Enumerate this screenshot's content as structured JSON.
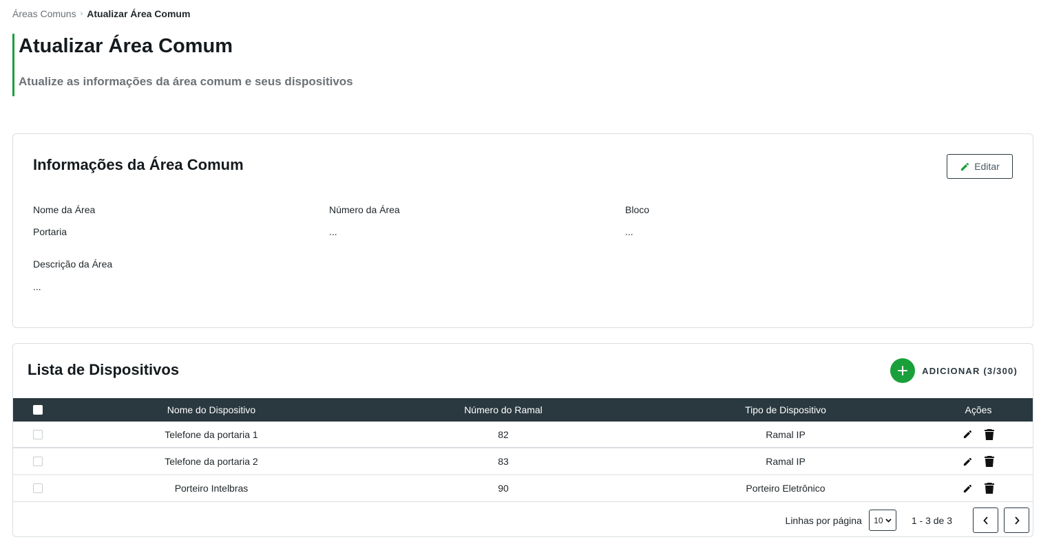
{
  "breadcrumb": {
    "parent": "Áreas Comuns",
    "separator": "›",
    "current": "Atualizar Área Comum"
  },
  "header": {
    "title": "Atualizar Área Comum",
    "subtitle": "Atualize as informações da área comum e seus dispositivos"
  },
  "info": {
    "title": "Informações da Área Comum",
    "edit_label": "Editar",
    "fields": {
      "name_label": "Nome da Área",
      "name_value": "Portaria",
      "number_label": "Número da Área",
      "number_value": "...",
      "block_label": "Bloco",
      "block_value": "...",
      "description_label": "Descrição da Área",
      "description_value": "..."
    }
  },
  "devices": {
    "title": "Lista de Dispositivos",
    "add_label": "ADICIONAR (3/300)",
    "columns": {
      "name": "Nome do Dispositivo",
      "ramal": "Número do Ramal",
      "type": "Tipo de Dispositivo",
      "actions": "Ações"
    },
    "rows": [
      {
        "name": "Telefone da portaria 1",
        "ramal": "82",
        "type": "Ramal IP"
      },
      {
        "name": "Telefone da portaria 2",
        "ramal": "83",
        "type": "Ramal IP"
      },
      {
        "name": "Porteiro Intelbras",
        "ramal": "90",
        "type": "Porteiro Eletrônico"
      }
    ],
    "pagination": {
      "rows_label": "Linhas por página",
      "rows_value": "10",
      "range": "1 - 3 de 3"
    }
  },
  "colors": {
    "accent": "#1aa03a",
    "table_header": "#2a383f"
  },
  "icons": [
    "pencil-icon",
    "plus-icon",
    "trash-icon",
    "chevron-left-icon",
    "chevron-right-icon",
    "chevron-down-icon"
  ]
}
